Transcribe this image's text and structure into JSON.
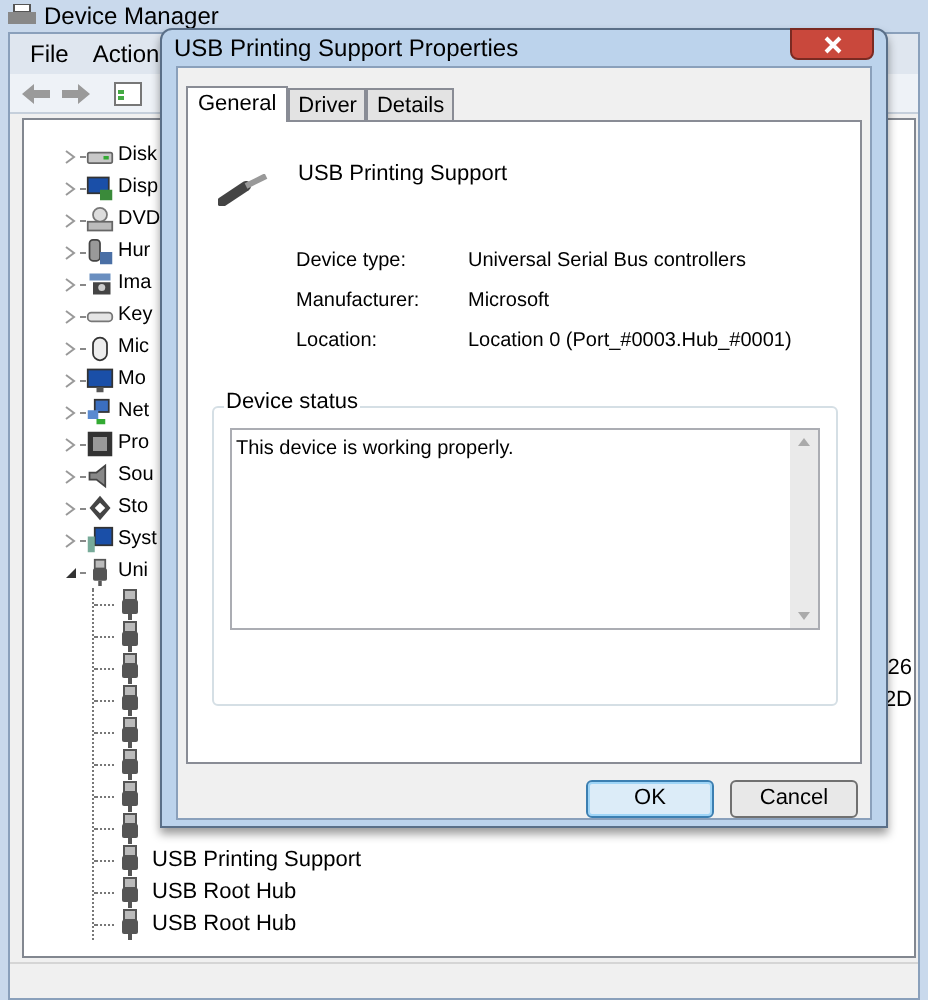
{
  "device_manager": {
    "title": "Device Manager",
    "menu": [
      "File",
      "Action"
    ],
    "tree": [
      {
        "label": "Disk",
        "kind": "disk",
        "expanded": false
      },
      {
        "label": "Disp",
        "kind": "display",
        "expanded": false
      },
      {
        "label": "DVD",
        "kind": "dvd",
        "expanded": false
      },
      {
        "label": "Hur",
        "kind": "hid",
        "expanded": false
      },
      {
        "label": "Ima",
        "kind": "imaging",
        "expanded": false
      },
      {
        "label": "Key",
        "kind": "keyboard",
        "expanded": false
      },
      {
        "label": "Mic",
        "kind": "mouse",
        "expanded": false
      },
      {
        "label": "Mo",
        "kind": "monitor",
        "expanded": false
      },
      {
        "label": "Net",
        "kind": "network",
        "expanded": false
      },
      {
        "label": "Pro",
        "kind": "processor",
        "expanded": false
      },
      {
        "label": "Sou",
        "kind": "sound",
        "expanded": false
      },
      {
        "label": "Sto",
        "kind": "storage",
        "expanded": false
      },
      {
        "label": "Syst",
        "kind": "system",
        "expanded": false
      },
      {
        "label": "Uni",
        "kind": "usb",
        "expanded": true,
        "children": [
          {
            "kind": "usb"
          },
          {
            "kind": "usb"
          },
          {
            "kind": "usb",
            "label": "26",
            "clipped": true
          },
          {
            "kind": "usb",
            "label": "2D",
            "clipped": true
          },
          {
            "kind": "usb"
          },
          {
            "kind": "usb"
          },
          {
            "kind": "usb"
          },
          {
            "kind": "usb"
          },
          {
            "kind": "usb",
            "label": "USB Printing Support"
          },
          {
            "kind": "usb",
            "label": "USB Root Hub"
          },
          {
            "kind": "usb",
            "label": "USB Root Hub"
          }
        ]
      }
    ]
  },
  "dialog": {
    "title": "USB Printing Support Properties",
    "tabs": [
      {
        "label": "General",
        "selected": true
      },
      {
        "label": "Driver",
        "selected": false
      },
      {
        "label": "Details",
        "selected": false
      }
    ],
    "device_name": "USB Printing Support",
    "properties": [
      {
        "label": "Device type:",
        "value": "Universal Serial Bus controllers"
      },
      {
        "label": "Manufacturer:",
        "value": "Microsoft"
      },
      {
        "label": "Location:",
        "value": "Location 0 (Port_#0003.Hub_#0001)"
      }
    ],
    "status_group": {
      "title": "Device status",
      "text": "This device is working properly."
    },
    "buttons": [
      {
        "label": "OK",
        "default": true
      },
      {
        "label": "Cancel",
        "default": false
      }
    ]
  }
}
